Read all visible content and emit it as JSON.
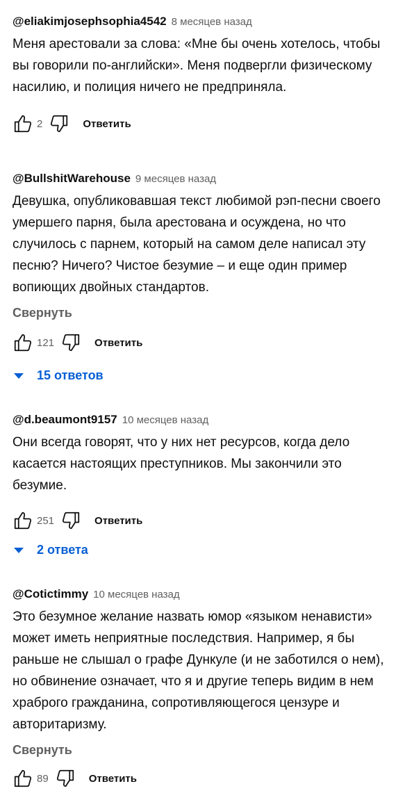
{
  "comments": [
    {
      "author": "@eliakimjosephsophia4542",
      "time": "8 месяцев назад",
      "text": "Меня арестовали за слова: «Мне бы очень хотелось, чтобы вы говорили по-английски». Меня подвергли физическому насилию, и полиция ничего не предприняла.",
      "likes": "2",
      "reply_label": "Ответить"
    },
    {
      "author": "@BullshitWarehouse",
      "time": "9 месяцев назад",
      "text": "Девушка, опубликовавшая текст любимой рэп-песни своего умершего парня, была арестована и осуждена, но что случилось с парнем, который на самом деле написал эту песню? Ничего? Чистое безумие – и еще один пример вопиющих двойных стандартов.",
      "collapse_label": "Свернуть",
      "likes": "121",
      "reply_label": "Ответить",
      "replies_label": "15 ответов"
    },
    {
      "author": "@d.beaumont9157",
      "time": "10 месяцев назад",
      "text": "Они всегда говорят, что у них нет ресурсов, когда дело касается настоящих преступников. Мы закончили это безумие.",
      "likes": "251",
      "reply_label": "Ответить",
      "replies_label": "2 ответа"
    },
    {
      "author": "@Cotictimmy",
      "time": "10 месяцев назад",
      "text": "Это безумное желание назвать юмор «языком ненависти» может иметь неприятные последствия. Например, я бы раньше не слышал о графе Дункуле (и не заботился о нем), но обвинение означает, что я и другие теперь видим в нем храброго гражданина, сопротивляющегося цензуре и авторитаризму.",
      "collapse_label": "Свернуть",
      "likes": "89",
      "reply_label": "Ответить"
    }
  ],
  "icons": {
    "like": "thumb-up-icon",
    "dislike": "thumb-down-icon",
    "expand": "caret-down-icon"
  },
  "colors": {
    "link_blue": "#065fd4",
    "secondary_text": "#606060",
    "primary_text": "#0f0f0f"
  }
}
